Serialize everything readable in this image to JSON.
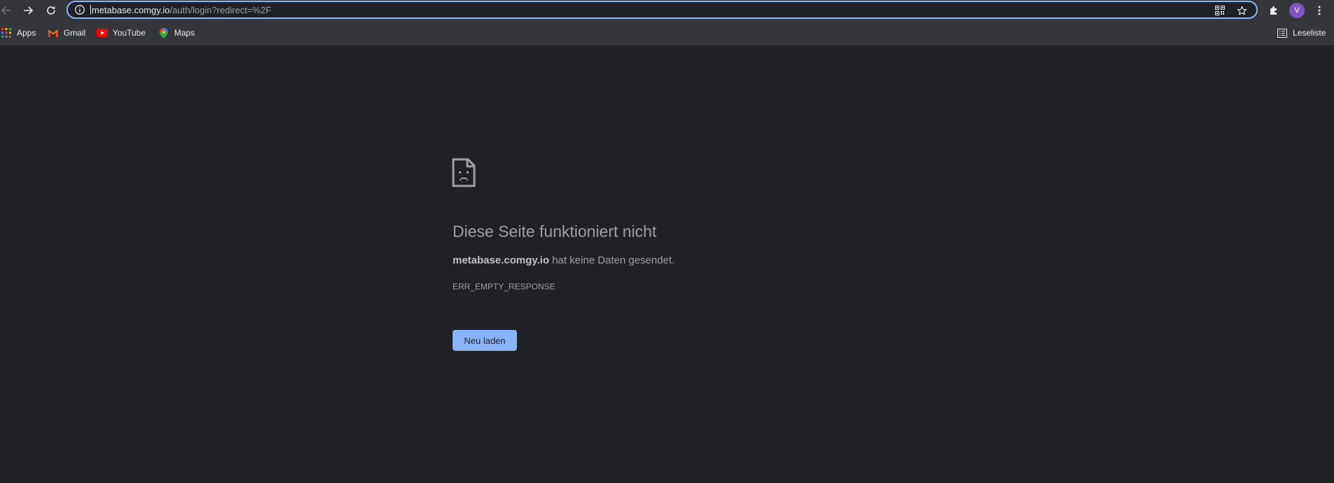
{
  "browser": {
    "url_host": "metabase.comgy.io",
    "url_path": "/auth/login?redirect=%2F",
    "avatar_initial": "V",
    "accent_color": "#8ab4f8",
    "icons": {
      "back": "arrow-left-icon",
      "forward": "arrow-right-icon",
      "reload": "reload-icon",
      "site_info": "info-icon",
      "qr": "qr-code-icon",
      "bookmark": "star-icon",
      "extensions": "puzzle-icon",
      "menu": "more-vertical-icon",
      "reading_list": "reading-list-icon"
    }
  },
  "bookmarks": {
    "items": [
      {
        "label": "Apps",
        "icon": "apps-grid-icon"
      },
      {
        "label": "Gmail",
        "icon": "gmail-icon"
      },
      {
        "label": "YouTube",
        "icon": "youtube-icon"
      },
      {
        "label": "Maps",
        "icon": "maps-pin-icon"
      }
    ],
    "reading_list": "Leseliste"
  },
  "error": {
    "icon": "sad-page-icon",
    "title": "Diese Seite funktioniert nicht",
    "host": "metabase.comgy.io",
    "message": " hat keine Daten gesendet.",
    "code": "ERR_EMPTY_RESPONSE",
    "reload_label": "Neu laden"
  }
}
